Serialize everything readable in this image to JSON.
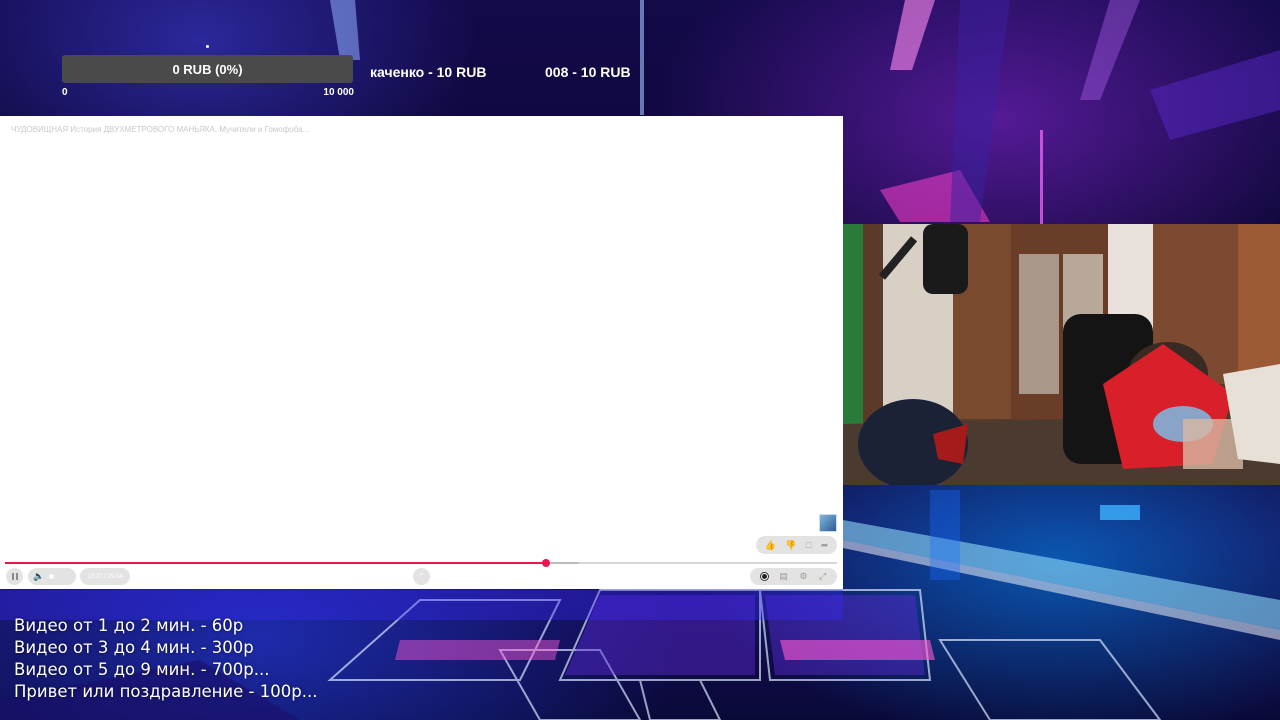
{
  "donation_goal": {
    "current_label": "0 RUB (0%)",
    "progress_fraction": 0,
    "min_label": "0",
    "max_label": "10 000"
  },
  "donation_ticker": {
    "items": [
      "каченко - 10 RUB",
      "008 - 10 RUB"
    ]
  },
  "video_player": {
    "title": "ЧУДОВИЩНАЯ История ДВУХМЕТРОВОГО МАНЬЯКА. Мучители и Гомофоба...",
    "time": "13:27 / 25:54",
    "played_fraction": 0.65,
    "buffered_fraction": 0.69,
    "accent_color": "#e7164d"
  },
  "price_list": {
    "lines": [
      "Видео от 1 до 2 мин. - 60р",
      "Видео от 3 до 4 мин. - 300р",
      "Видео от 5 до 9 мин. - 700р...",
      "Привет или поздравление - 100р..."
    ]
  }
}
